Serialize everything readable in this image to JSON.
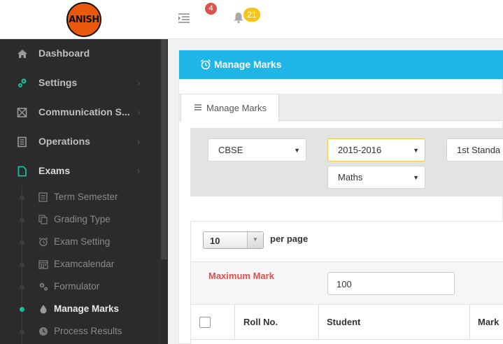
{
  "brand": {
    "logo_text": "ANISH"
  },
  "topbar": {
    "messages_count": "4",
    "notifications_count": "21"
  },
  "sidebar": {
    "items": [
      {
        "label": "Dashboard",
        "icon": "home-icon"
      },
      {
        "label": "Settings",
        "icon": "cogs-icon"
      },
      {
        "label": "Communication S...",
        "icon": "envelope-icon"
      },
      {
        "label": "Operations",
        "icon": "list-icon"
      },
      {
        "label": "Exams",
        "icon": "file-icon"
      }
    ],
    "sub_items": [
      {
        "label": "Term Semester",
        "icon": "list-alt-icon"
      },
      {
        "label": "Grading Type",
        "icon": "copy-icon"
      },
      {
        "label": "Exam Setting",
        "icon": "alarm-clock-icon"
      },
      {
        "label": "Examcalendar",
        "icon": "calendar-icon"
      },
      {
        "label": "Formulator",
        "icon": "cogs-icon"
      },
      {
        "label": "Manage Marks",
        "icon": "drop-icon"
      },
      {
        "label": "Process Results",
        "icon": "clock-icon"
      }
    ]
  },
  "page": {
    "title": "Manage Marks",
    "tab_label": "Manage Marks",
    "filters": {
      "board": "CBSE",
      "session": "2015-2016",
      "standard": "1st Standa",
      "subject": "Maths"
    },
    "per_page_value": "10",
    "per_page_label": "per page",
    "max_mark_label": "Maximum Mark",
    "max_mark_value": "100",
    "table_headers": [
      "Roll No.",
      "Student",
      "Mark"
    ]
  },
  "colors": {
    "header_blue": "#1fb5e6",
    "sidebar_bg": "#2b2b2b",
    "accent_green": "#1abc9c",
    "badge_red": "#d9534f",
    "badge_yellow": "#f6c519",
    "max_mark_red": "#d9534f"
  }
}
